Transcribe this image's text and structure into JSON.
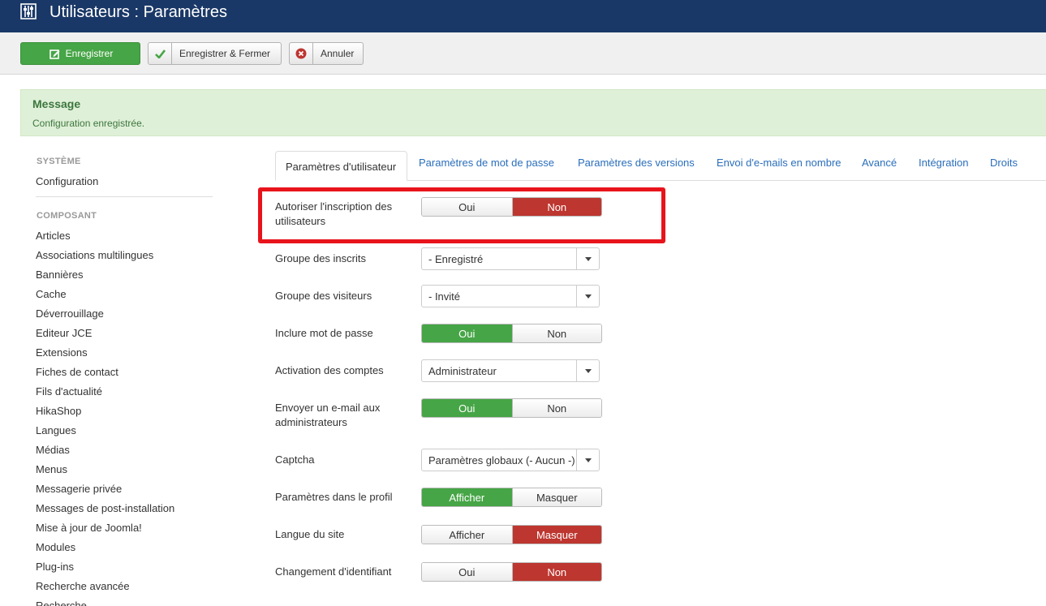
{
  "header": {
    "title": "Utilisateurs : Paramètres",
    "icon": "sliders-icon"
  },
  "toolbar": {
    "save_label": "Enregistrer",
    "save_close_label": "Enregistrer & Fermer",
    "cancel_label": "Annuler"
  },
  "alert": {
    "heading": "Message",
    "message": "Configuration enregistrée."
  },
  "sidebar": {
    "system_heading": "SYSTÈME",
    "configuration": "Configuration",
    "component_heading": "COMPOSANT",
    "items": [
      "Articles",
      "Associations multilingues",
      "Bannières",
      "Cache",
      "Déverrouillage",
      "Editeur JCE",
      "Extensions",
      "Fiches de contact",
      "Fils d'actualité",
      "HikaShop",
      "Langues",
      "Médias",
      "Menus",
      "Messagerie privée",
      "Messages de post-installation",
      "Mise à jour de Joomla!",
      "Modules",
      "Plug-ins",
      "Recherche avancée",
      "Recherche"
    ]
  },
  "tabs": [
    "Paramètres d'utilisateur",
    "Paramètres de mot de passe",
    "Paramètres des versions",
    "Envoi d'e-mails en nombre",
    "Avancé",
    "Intégration",
    "Droits"
  ],
  "fields": {
    "allow_registration": {
      "label": "Autoriser l'inscription des utilisateurs",
      "opt1": "Oui",
      "opt2": "Non",
      "selected": "Non"
    },
    "new_user_group": {
      "label": "Groupe des inscrits",
      "value": "- Enregistré"
    },
    "guest_group": {
      "label": "Groupe des visiteurs",
      "value": "- Invité"
    },
    "send_password": {
      "label": "Inclure mot de passe",
      "opt1": "Oui",
      "opt2": "Non",
      "selected": "Oui"
    },
    "activation": {
      "label": "Activation des comptes",
      "value": "Administrateur"
    },
    "notify_admins": {
      "label": "Envoyer un e-mail aux administrateurs",
      "opt1": "Oui",
      "opt2": "Non",
      "selected": "Oui"
    },
    "captcha": {
      "label": "Captcha",
      "value": "Paramètres globaux (- Aucun -)"
    },
    "profile_params": {
      "label": "Paramètres dans le profil",
      "opt1": "Afficher",
      "opt2": "Masquer",
      "selected": "Afficher"
    },
    "site_language": {
      "label": "Langue du site",
      "opt1": "Afficher",
      "opt2": "Masquer",
      "selected": "Masquer"
    },
    "change_login": {
      "label": "Changement d'identifiant",
      "opt1": "Oui",
      "opt2": "Non",
      "selected": "Non"
    }
  },
  "colors": {
    "header_bg": "#1a3867",
    "success": "#46a546",
    "danger": "#bd362f",
    "highlight": "#e8141c",
    "link": "#2a6ebb"
  }
}
